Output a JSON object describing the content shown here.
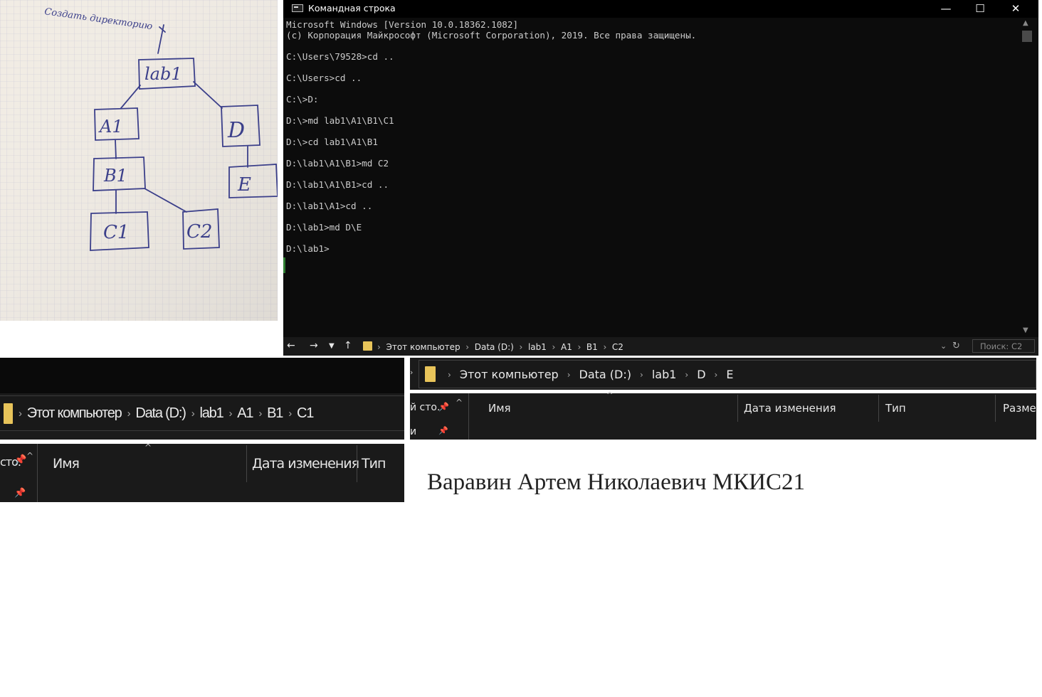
{
  "photo": {
    "header_text": "Создать директорию",
    "nodes": [
      "lab1",
      "A1",
      "B1",
      "C1",
      "C2",
      "D",
      "E"
    ],
    "root_mark": "\\"
  },
  "cmd": {
    "title": "Командная строка",
    "lines": [
      "Microsoft Windows [Version 10.0.18362.1082]",
      "(c) Корпорация Майкрософт (Microsoft Corporation), 2019. Все права защищены.",
      "",
      "C:\\Users\\79528>cd ..",
      "",
      "C:\\Users>cd ..",
      "",
      "C:\\>D:",
      "",
      "D:\\>md lab1\\A1\\B1\\C1",
      "",
      "D:\\>cd lab1\\A1\\B1",
      "",
      "D:\\lab1\\A1\\B1>md C2",
      "",
      "D:\\lab1\\A1\\B1>cd ..",
      "",
      "D:\\lab1\\A1>cd ..",
      "",
      "D:\\lab1>md D\\E",
      "",
      "D:\\lab1>"
    ],
    "minimize": "—",
    "maximize": "☐",
    "close": "✕"
  },
  "explorer_c2": {
    "crumbs": [
      "Этот компьютер",
      "Data (D:)",
      "lab1",
      "A1",
      "B1",
      "C2"
    ],
    "search_placeholder": "Поиск: C2"
  },
  "explorer_c1": {
    "crumbs": [
      "Этот компьютер",
      "Data (D:)",
      "lab1",
      "A1",
      "B1",
      "C1"
    ],
    "columns": [
      "Имя",
      "Дата изменения",
      "Тип"
    ],
    "left_label": "сто."
  },
  "explorer_e": {
    "crumbs": [
      "Этот компьютер",
      "Data (D:)",
      "lab1",
      "D",
      "E"
    ],
    "columns": [
      "Имя",
      "Дата изменения",
      "Тип",
      "Разме"
    ],
    "left_label": "й сто.",
    "left_label2": "и"
  },
  "author": "Варавин Артем Николаевич МКИС21",
  "colors": {
    "cmd_bg": "#0c0c0c",
    "explorer_bg": "#191919",
    "folder": "#e8c45a"
  }
}
